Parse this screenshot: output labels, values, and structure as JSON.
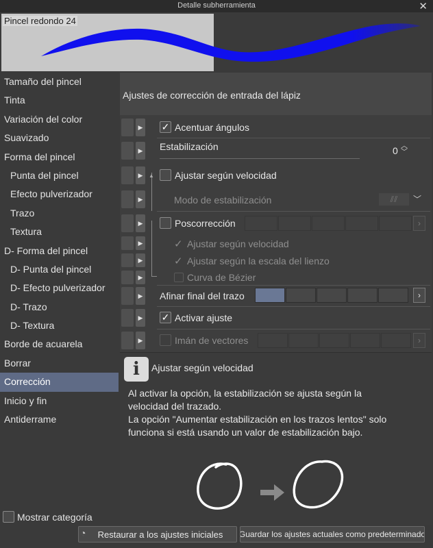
{
  "window": {
    "title": "Detalle subherramienta",
    "close_glyph": "✕"
  },
  "preview": {
    "brush_name": "Pincel redondo 24",
    "stroke_color": "#1010ee"
  },
  "sidebar": {
    "items": [
      {
        "label": "Tamaño del pincel",
        "sub": false
      },
      {
        "label": "Tinta",
        "sub": false
      },
      {
        "label": "Variación del color",
        "sub": false
      },
      {
        "label": "Suavizado",
        "sub": false
      },
      {
        "label": "Forma del pincel",
        "sub": false
      },
      {
        "label": "Punta del pincel",
        "sub": true
      },
      {
        "label": "Efecto pulverizador",
        "sub": true
      },
      {
        "label": "Trazo",
        "sub": true
      },
      {
        "label": "Textura",
        "sub": true
      },
      {
        "label": "D- Forma del pincel",
        "sub": false
      },
      {
        "label": "D- Punta del pincel",
        "sub": true
      },
      {
        "label": "D- Efecto pulverizador",
        "sub": true
      },
      {
        "label": "D- Trazo",
        "sub": true
      },
      {
        "label": "D- Textura",
        "sub": true
      },
      {
        "label": "Borde de acuarela",
        "sub": false
      },
      {
        "label": "Borrar",
        "sub": false
      },
      {
        "label": "Corrección",
        "sub": false,
        "active": true
      },
      {
        "label": "Inicio y fin",
        "sub": false
      },
      {
        "label": "Antiderrame",
        "sub": false
      }
    ],
    "show_category_label": "Mostrar categoría",
    "show_category_checked": false
  },
  "content": {
    "header": "Ajustes de corrección de entrada del lápiz",
    "acentuar_label": "Acentuar ángulos",
    "acentuar_checked": true,
    "estabilizacion_label": "Estabilización",
    "estabilizacion_value": "0",
    "ajustar_velocidad_label": "Ajustar según velocidad",
    "ajustar_velocidad_checked": false,
    "modo_label": "Modo de estabilización",
    "poscorreccion_label": "Poscorrección",
    "poscorreccion_checked": false,
    "pos_velocidad_label": "Ajustar según velocidad",
    "pos_escala_label": "Ajustar según la escala del lienzo",
    "pos_bezier_label": "Curva de Bézier",
    "afinar_label": "Afinar final del trazo",
    "activar_label": "Activar ajuste",
    "activar_checked": true,
    "iman_label": "Imán de vectores",
    "check_glyph": "✓"
  },
  "info": {
    "icon_glyph": "i",
    "title": "Ajustar según velocidad",
    "body_line1": "Al activar la opción, la estabilización se ajusta según la",
    "body_line2": "velocidad del trazado.",
    "body_line3": "La opción \"Aumentar estabilización en los trazos lentos\" solo",
    "body_line4": "funciona si está usando un valor de estabilización bajo."
  },
  "footer": {
    "reset_label": "Restaurar a los ajustes iniciales",
    "save_label": "Guardar los ajustes actuales como predeterminado"
  }
}
